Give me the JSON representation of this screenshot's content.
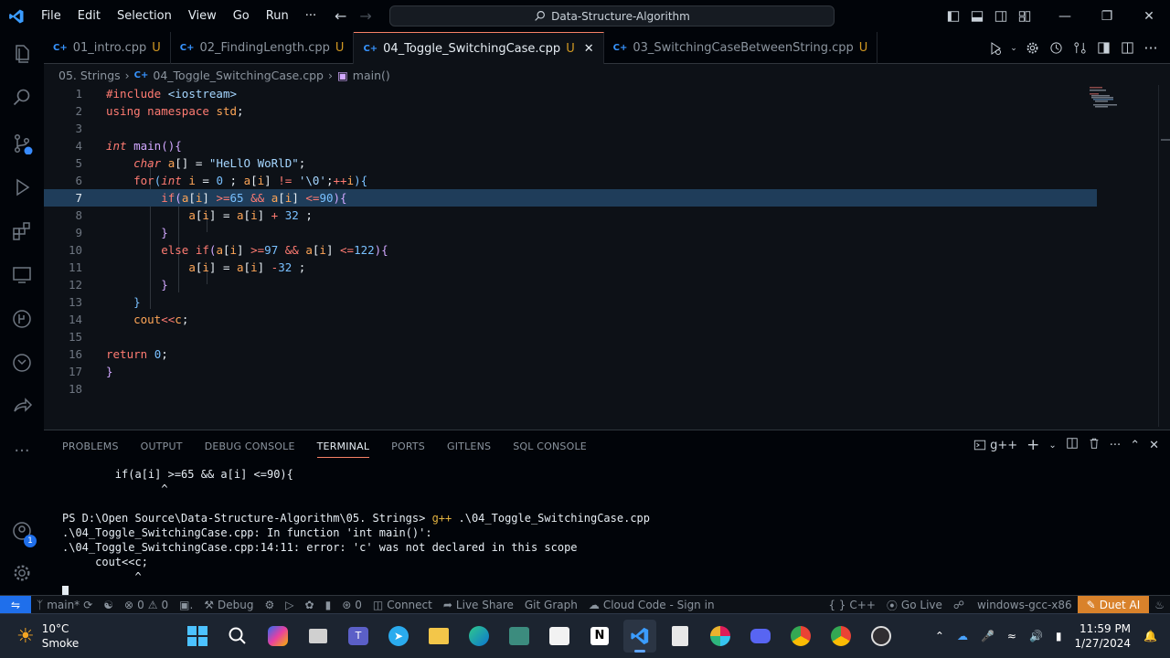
{
  "titlebar": {
    "menu": [
      "File",
      "Edit",
      "Selection",
      "View",
      "Go",
      "Run",
      "···"
    ],
    "search_text": "Data-Structure-Algorithm"
  },
  "tabs": [
    {
      "label": "01_intro.cpp",
      "status": "U",
      "icon": "C++"
    },
    {
      "label": "02_FindingLength.cpp",
      "status": "U",
      "icon": "C++"
    },
    {
      "label": "04_Toggle_SwitchingCase.cpp",
      "status": "U",
      "icon": "C++",
      "active": true
    },
    {
      "label": "03_SwitchingCaseBetweenString.cpp",
      "status": "U",
      "icon": "C++"
    }
  ],
  "breadcrumb": {
    "folder": "05. Strings",
    "file": "04_Toggle_SwitchingCase.cpp",
    "symbol": "main()"
  },
  "editor": {
    "line_numbers": [
      "1",
      "2",
      "3",
      "4",
      "5",
      "6",
      "7",
      "8",
      "9",
      "10",
      "11",
      "12",
      "13",
      "14",
      "15",
      "16",
      "17",
      "18"
    ],
    "highlight_line": 7
  },
  "panel": {
    "tabs": [
      "PROBLEMS",
      "OUTPUT",
      "DEBUG CONSOLE",
      "TERMINAL",
      "PORTS",
      "GITLENS",
      "SQL CONSOLE"
    ],
    "active_tab": "TERMINAL",
    "shell_label": "g++",
    "terminal_lines": [
      "        if(a[i] >=65 && a[i] <=90){",
      "               ^",
      "",
      "PS D:\\Open Source\\Data-Structure-Algorithm\\05. Strings> ",
      ".\\04_Toggle_SwitchingCase.cpp: In function 'int main()':",
      ".\\04_Toggle_SwitchingCase.cpp:14:11: error: 'c' was not declared in this scope",
      "     cout<<c;",
      "           ^"
    ],
    "prompt_command": "g++",
    "prompt_args": " .\\04_Toggle_SwitchingCase.cpp"
  },
  "statusbar": {
    "branch": "main*",
    "errors": "0",
    "warnings": "0",
    "debug": "Debug",
    "ports": "0",
    "connect": "Connect",
    "live_share": "Live Share",
    "git_graph": "Git Graph",
    "cloud_code": "Cloud Code - Sign in",
    "language": "C++",
    "go_live": "Go Live",
    "compiler": "windows-gcc-x86",
    "duet": "Duet AI"
  },
  "taskbar": {
    "temperature": "10°C",
    "weather": "Smoke",
    "time": "11:59 PM",
    "date": "1/27/2024"
  },
  "colors": {
    "accent_blue": "#1f6feb",
    "duet_orange": "#d9822b",
    "line_highlight": "#1f3d5a"
  },
  "activity_badge": "1"
}
